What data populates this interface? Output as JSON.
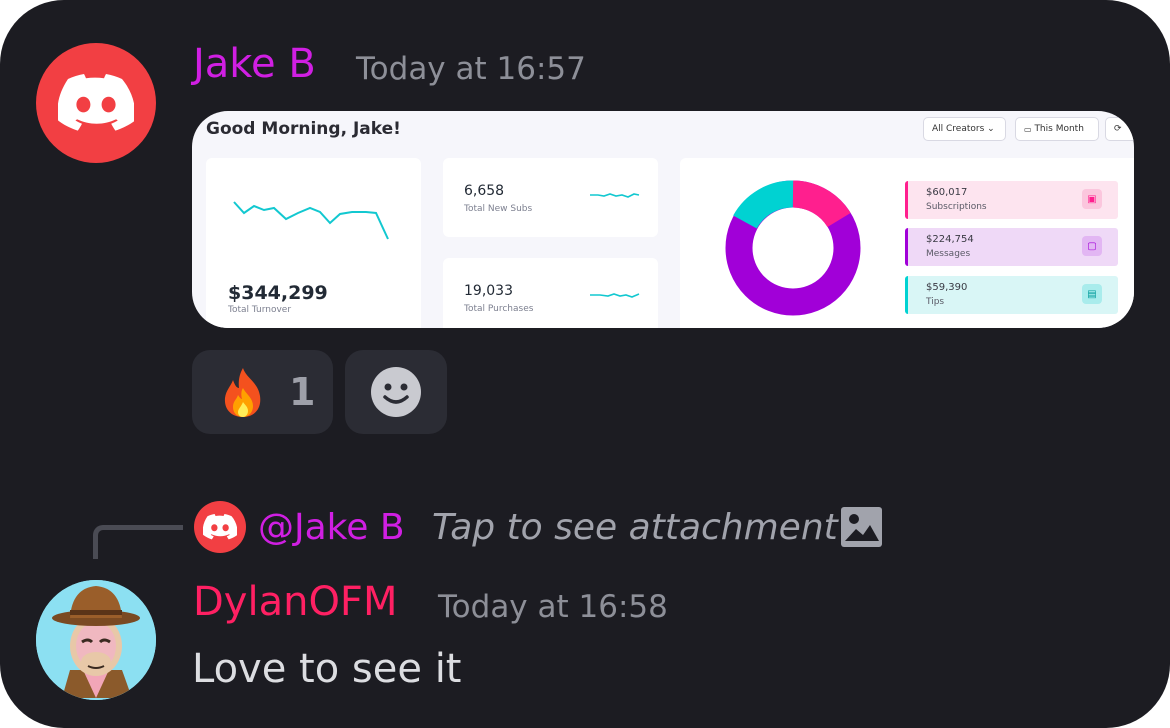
{
  "message1": {
    "author": "Jake B",
    "author_color": "#d01fe3",
    "timestamp": "Today at 16:57",
    "avatar_icon": "discord-logo-icon"
  },
  "attachment": {
    "greeting": "Good Morning, Jake!",
    "filter_creators": "All Creators",
    "filter_period": "This Month",
    "turnover_value": "$344,299",
    "turnover_label": "Total Turnover",
    "new_subs_value": "6,658",
    "new_subs_label": "Total New Subs",
    "purchases_value": "19,033",
    "purchases_label": "Total Purchases",
    "breakdown": [
      {
        "value": "$60,017",
        "label": "Subscriptions",
        "color": "#ff1f8e",
        "bg": "#fde4ef",
        "icon": "lock-icon"
      },
      {
        "value": "$224,754",
        "label": "Messages",
        "color": "#a100d8",
        "bg": "#efd9f7",
        "icon": "chat-icon"
      },
      {
        "value": "$59,390",
        "label": "Tips",
        "color": "#00d2d2",
        "bg": "#d9f6f6",
        "icon": "cash-icon"
      }
    ]
  },
  "reactions": [
    {
      "emoji": "🔥",
      "count": "1"
    },
    {
      "emoji": "add-reaction-icon",
      "count": ""
    }
  ],
  "reply": {
    "author": "@Jake B",
    "text": "Tap to see attachment",
    "icon": "image-icon"
  },
  "message2": {
    "author": "DylanOFM",
    "author_color": "#ff2063",
    "timestamp": "Today at 16:58",
    "content": "Love to see it"
  }
}
